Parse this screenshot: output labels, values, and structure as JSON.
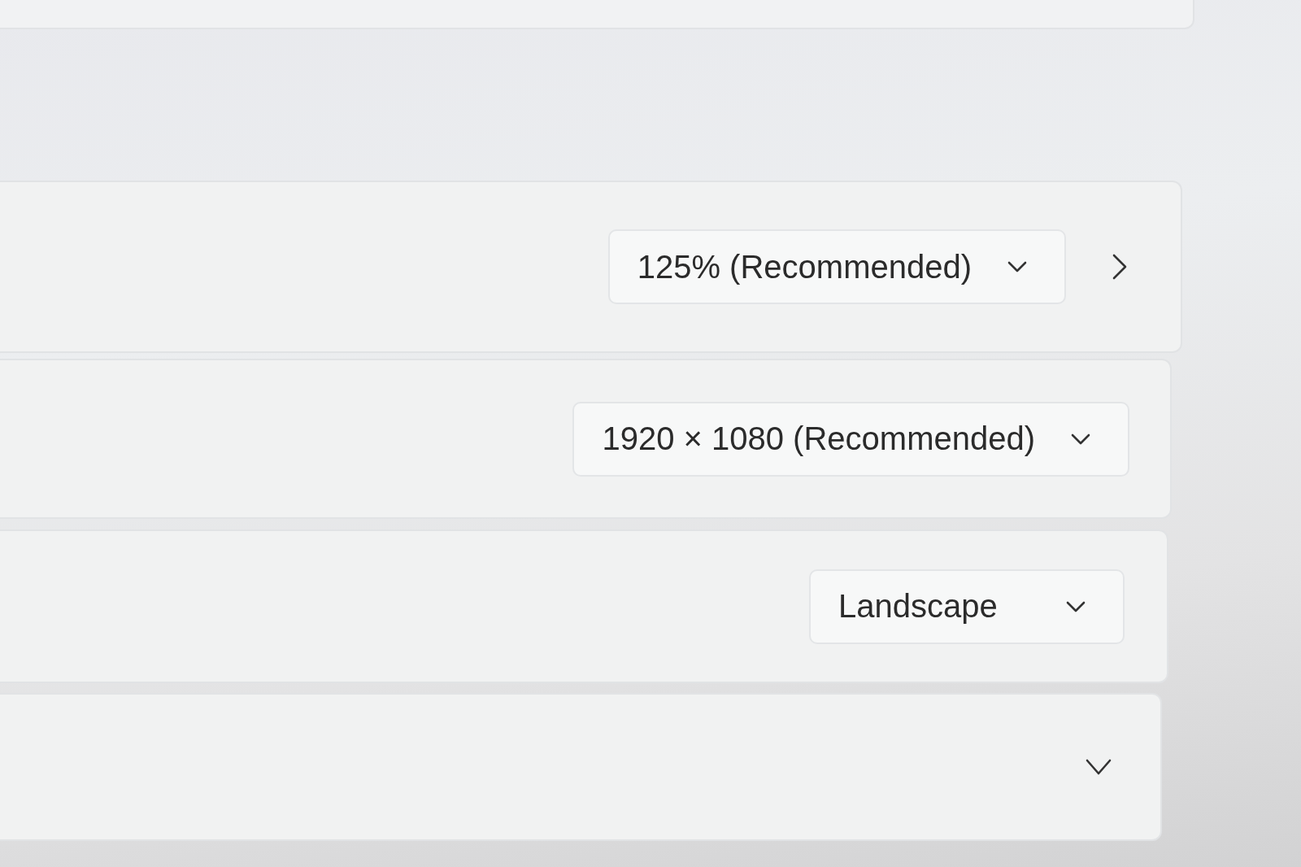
{
  "settings": [
    {
      "kind": "dropdown",
      "value": "125% (Recommended)",
      "opens_page": true
    },
    {
      "kind": "dropdown",
      "value": "1920 × 1080 (Recommended)",
      "opens_page": false
    },
    {
      "kind": "dropdown",
      "value": "Landscape",
      "opens_page": false
    },
    {
      "kind": "expander",
      "expanded": false
    }
  ]
}
